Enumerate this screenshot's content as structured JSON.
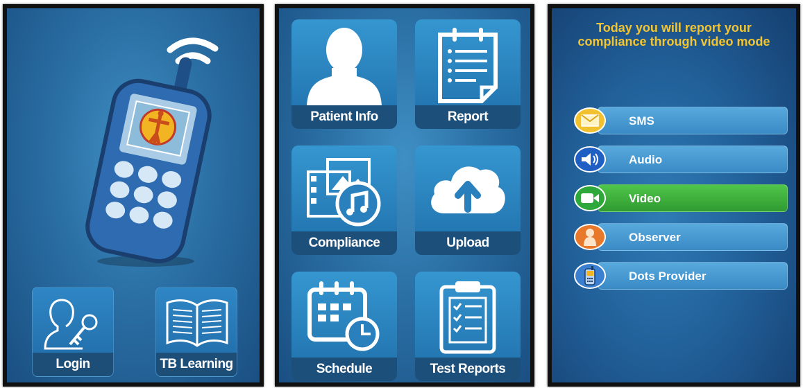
{
  "screen1": {
    "tiles": [
      {
        "label": "Login",
        "icon": "user-key-icon"
      },
      {
        "label": "TB Learning",
        "icon": "open-book-icon"
      }
    ],
    "illustration": "mobile-phone-icon"
  },
  "screen2": {
    "tiles": [
      {
        "label": "Patient Info",
        "icon": "person-silhouette-icon"
      },
      {
        "label": "Report",
        "icon": "notepad-list-icon"
      },
      {
        "label": "Compliance",
        "icon": "media-music-icon"
      },
      {
        "label": "Upload",
        "icon": "cloud-upload-icon"
      },
      {
        "label": "Schedule",
        "icon": "calendar-clock-icon"
      },
      {
        "label": "Test Reports",
        "icon": "clipboard-checklist-icon"
      }
    ]
  },
  "screen3": {
    "headline_line1": "Today you will report your",
    "headline_line2": "compliance through video mode",
    "options": [
      {
        "label": "SMS",
        "icon": "envelope-icon",
        "color": "#f2c12e",
        "selected": false
      },
      {
        "label": "Audio",
        "icon": "speaker-icon",
        "color": "#1f5fc4",
        "selected": false
      },
      {
        "label": "Video",
        "icon": "video-camera-icon",
        "color": "#2ea83a",
        "selected": true
      },
      {
        "label": "Observer",
        "icon": "person-icon",
        "color": "#e8782a",
        "selected": false
      },
      {
        "label": "Dots Provider",
        "icon": "mobile-phone-icon",
        "color": "#3a7fd0",
        "selected": false
      }
    ]
  },
  "colors": {
    "background_blue": "#2a6fa4",
    "label_bar": "#1d4f7b",
    "headline_yellow": "#f4c530",
    "selected_green": "#2f9a31"
  }
}
